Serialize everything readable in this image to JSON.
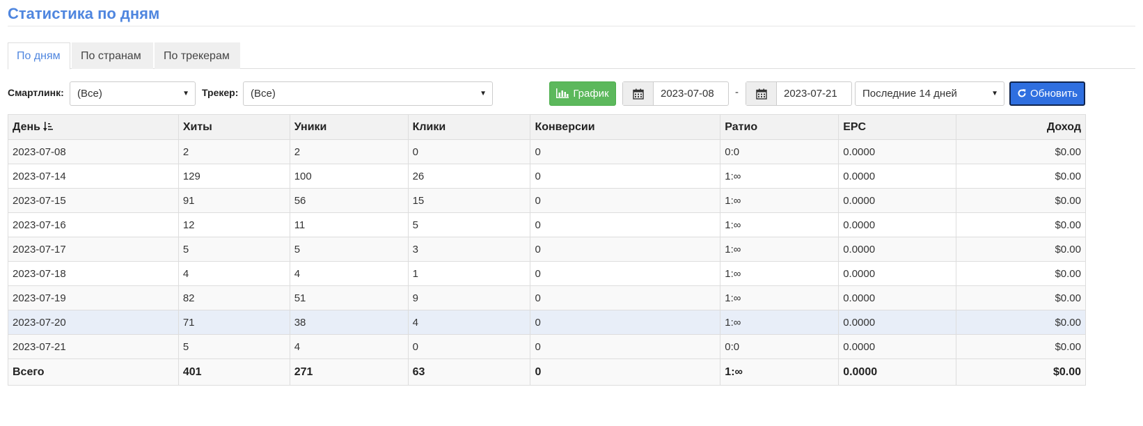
{
  "page": {
    "title": "Статистика по дням"
  },
  "tabs": [
    {
      "label": "По дням",
      "active": true
    },
    {
      "label": "По странам",
      "active": false
    },
    {
      "label": "По трекерам",
      "active": false
    }
  ],
  "filters": {
    "smartlink": {
      "label": "Смартлинк:",
      "value": "(Все)"
    },
    "tracker": {
      "label": "Трекер:",
      "value": "(Все)"
    },
    "chart_button": "График",
    "date_from": "2023-07-08",
    "date_separator": "-",
    "date_to": "2023-07-21",
    "period": "Последние 14 дней",
    "refresh_button": "Обновить"
  },
  "table": {
    "columns": [
      "День",
      "Хиты",
      "Уники",
      "Клики",
      "Конверсии",
      "Ратио",
      "EPC",
      "Доход"
    ],
    "rows": [
      [
        "2023-07-08",
        "2",
        "2",
        "0",
        "0",
        "0:0",
        "0.0000",
        "$0.00"
      ],
      [
        "2023-07-14",
        "129",
        "100",
        "26",
        "0",
        "1:∞",
        "0.0000",
        "$0.00"
      ],
      [
        "2023-07-15",
        "91",
        "56",
        "15",
        "0",
        "1:∞",
        "0.0000",
        "$0.00"
      ],
      [
        "2023-07-16",
        "12",
        "11",
        "5",
        "0",
        "1:∞",
        "0.0000",
        "$0.00"
      ],
      [
        "2023-07-17",
        "5",
        "5",
        "3",
        "0",
        "1:∞",
        "0.0000",
        "$0.00"
      ],
      [
        "2023-07-18",
        "4",
        "4",
        "1",
        "0",
        "1:∞",
        "0.0000",
        "$0.00"
      ],
      [
        "2023-07-19",
        "82",
        "51",
        "9",
        "0",
        "1:∞",
        "0.0000",
        "$0.00"
      ],
      [
        "2023-07-20",
        "71",
        "38",
        "4",
        "0",
        "1:∞",
        "0.0000",
        "$0.00"
      ],
      [
        "2023-07-21",
        "5",
        "4",
        "0",
        "0",
        "0:0",
        "0.0000",
        "$0.00"
      ]
    ],
    "totals": [
      "Всего",
      "401",
      "271",
      "63",
      "0",
      "1:∞",
      "0.0000",
      "$0.00"
    ]
  },
  "colors": {
    "accent": "#4f86df",
    "chart_button": "#5cb85c",
    "refresh_button": "#2f6fe0",
    "highlight_row": "#e8eef8"
  }
}
